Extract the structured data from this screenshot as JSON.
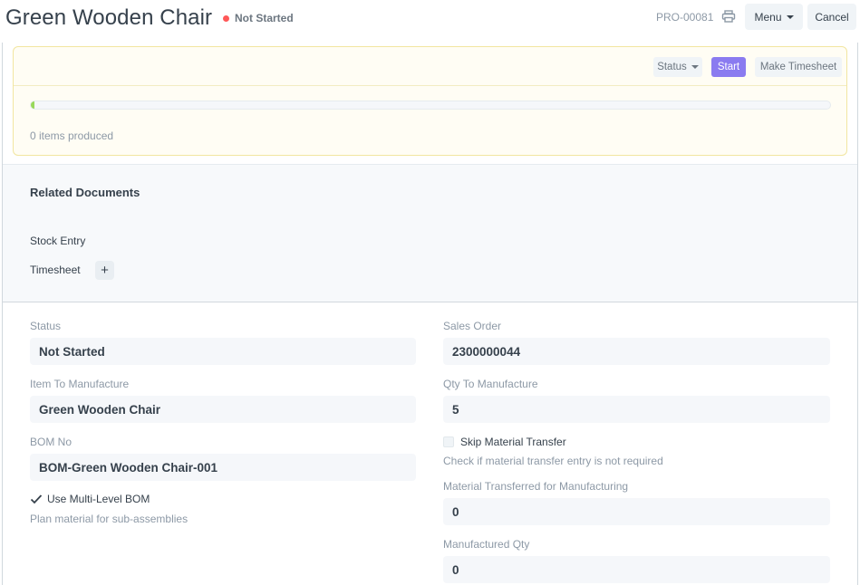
{
  "header": {
    "title": "Green Wooden Chair",
    "status": "Not Started",
    "status_color": "#ff5858",
    "docname": "PRO-00081",
    "print_icon": "printer-icon",
    "menu_label": "Menu",
    "cancel_label": "Cancel"
  },
  "dashboard": {
    "status_button": "Status",
    "start_button": "Start",
    "timesheet_button": "Make Timesheet",
    "progress_fraction": 0.005,
    "items_produced": "0 items produced",
    "accent_color": "#8a7bf0",
    "progress_color": "#98d85b"
  },
  "related": {
    "title": "Related Documents",
    "items": [
      {
        "label": "Stock Entry"
      },
      {
        "label": "Timesheet",
        "add": "+"
      }
    ]
  },
  "fields": {
    "status": {
      "label": "Status",
      "value": "Not Started"
    },
    "item_to_manufacture": {
      "label": "Item To Manufacture",
      "value": "Green Wooden Chair"
    },
    "bom_no": {
      "label": "BOM No",
      "value": "BOM-Green Wooden Chair-001"
    },
    "use_multi_level_bom": {
      "label": "Use Multi-Level BOM",
      "checked": true,
      "description": "Plan material for sub-assemblies"
    },
    "sales_order": {
      "label": "Sales Order",
      "value": "2300000044"
    },
    "qty_to_manufacture": {
      "label": "Qty To Manufacture",
      "value": "5"
    },
    "skip_material_transfer": {
      "label": "Skip Material Transfer",
      "checked": false,
      "description": "Check if material transfer entry is not required"
    },
    "material_transferred": {
      "label": "Material Transferred for Manufacturing",
      "value": "0"
    },
    "manufactured_qty": {
      "label": "Manufactured Qty",
      "value": "0"
    }
  }
}
